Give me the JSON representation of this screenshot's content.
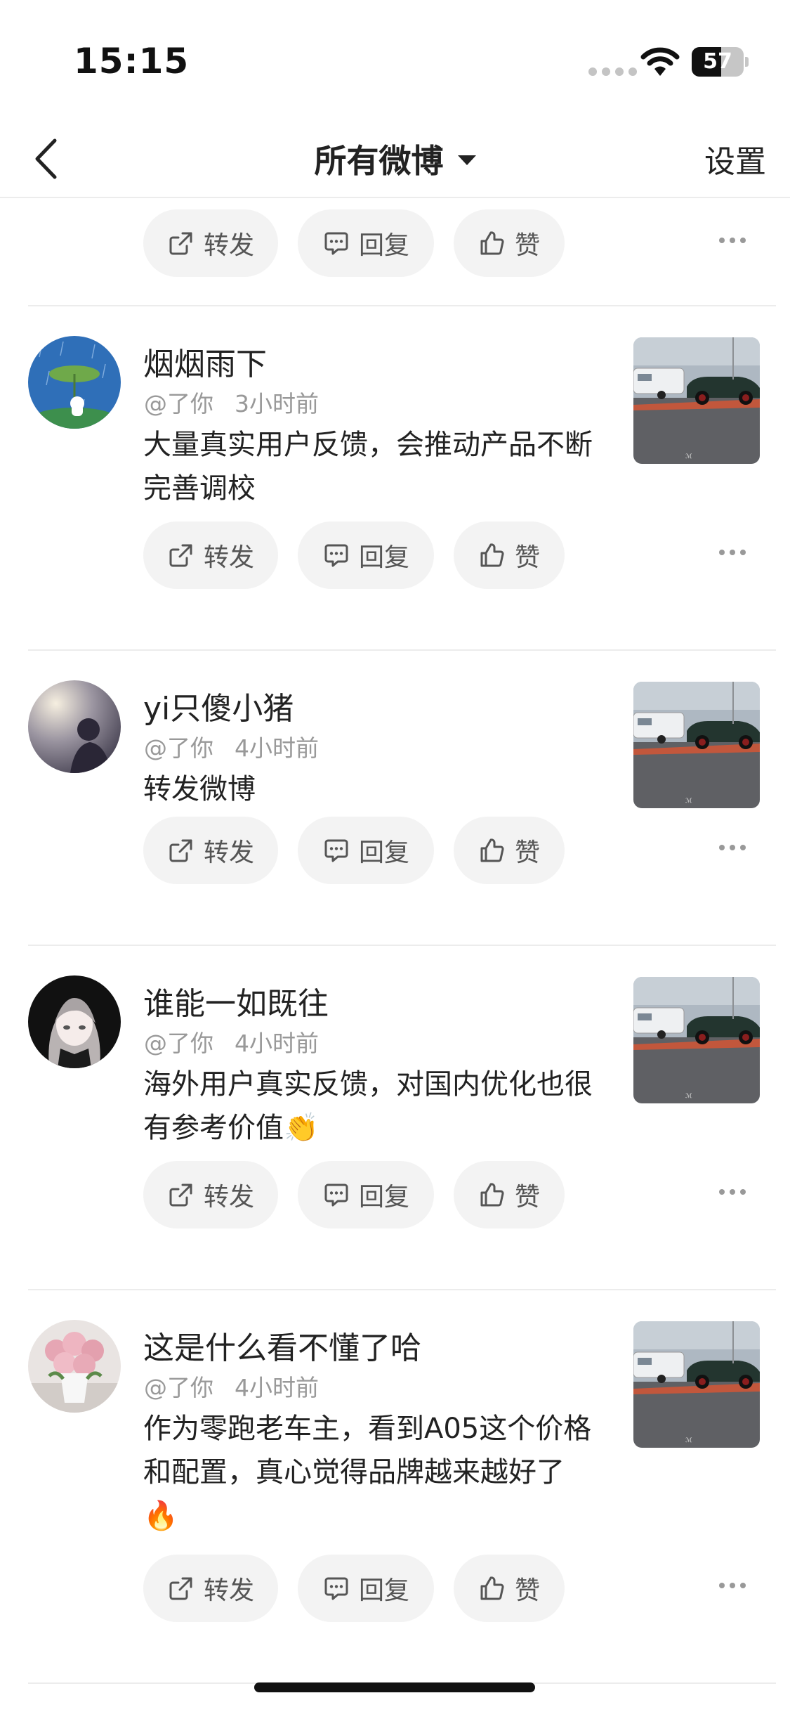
{
  "status_bar": {
    "time": "15:15",
    "battery_level": "57",
    "battery_fraction": 0.57
  },
  "nav": {
    "title": "所有微博",
    "settings_label": "设置"
  },
  "actions": {
    "repost": "转发",
    "reply": "回复",
    "like": "赞"
  },
  "comments": [
    {
      "name": "烟烟雨下",
      "mention": "@了你",
      "time": "3小时前",
      "text": "大量真实用户反馈，会推动产品不断完善调校",
      "emoji": ""
    },
    {
      "name": "yi只傻小猪",
      "mention": "@了你",
      "time": "4小时前",
      "text": "转发微博",
      "emoji": ""
    },
    {
      "name": "谁能一如既往",
      "mention": "@了你",
      "time": "4小时前",
      "text": "海外用户真实反馈，对国内优化也很有参考价值",
      "emoji": "👏"
    },
    {
      "name": "这是什么看不懂了哈",
      "mention": "@了你",
      "time": "4小时前",
      "text": "作为零跑老车主，看到A05这个价格和配置，真心觉得品牌越来越好了",
      "emoji": "🔥"
    }
  ]
}
